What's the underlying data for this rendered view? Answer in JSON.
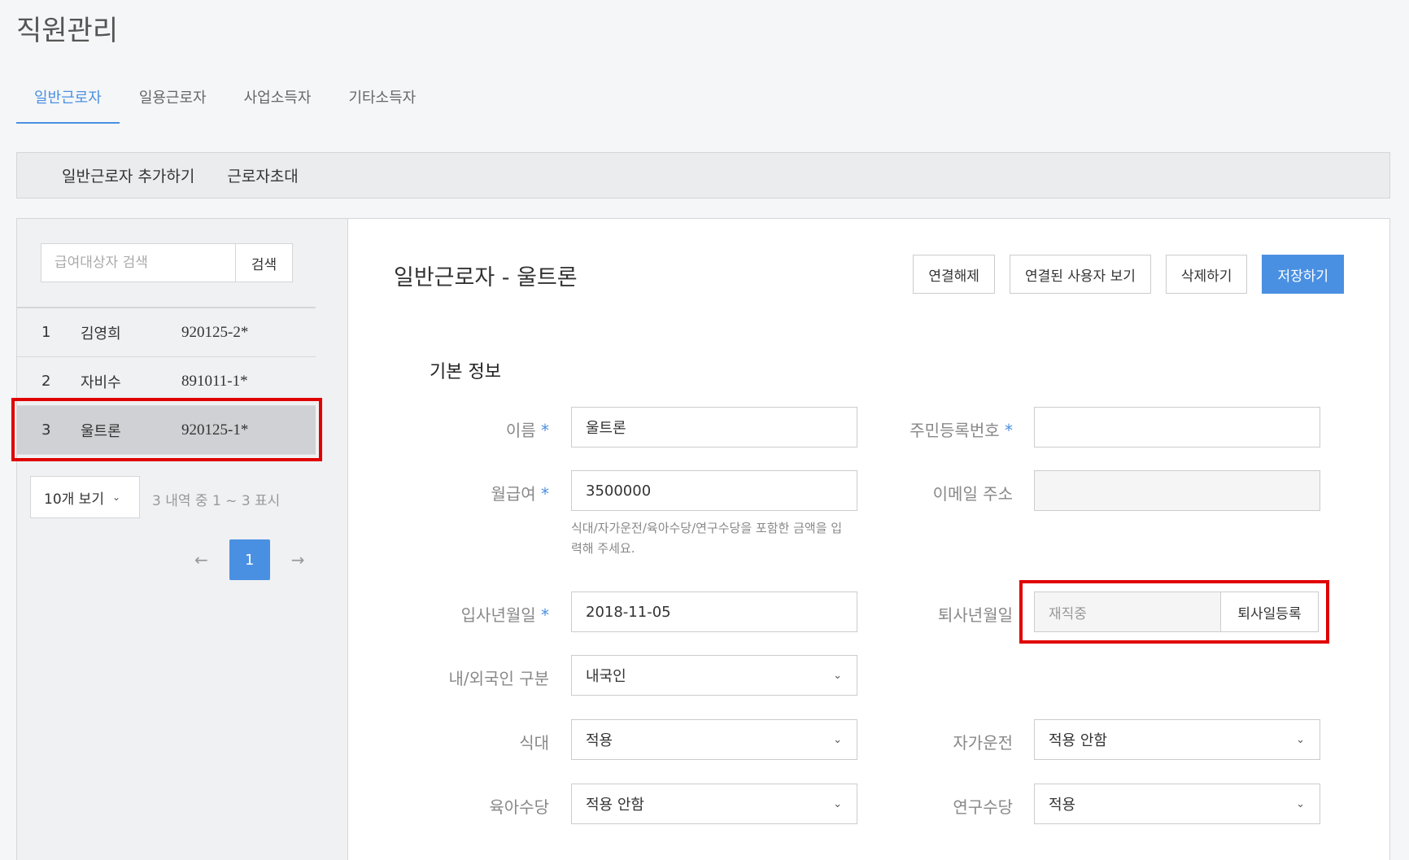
{
  "page": {
    "title": "직원관리"
  },
  "tabs": [
    {
      "label": "일반근로자",
      "active": true
    },
    {
      "label": "일용근로자",
      "active": false
    },
    {
      "label": "사업소득자",
      "active": false
    },
    {
      "label": "기타소득자",
      "active": false
    }
  ],
  "toolbar": {
    "add_label": "일반근로자 추가하기",
    "invite_label": "근로자초대"
  },
  "sidebar": {
    "search": {
      "placeholder": "급여대상자 검색",
      "button": "검색"
    },
    "employees": [
      {
        "no": "1",
        "name": "김영희",
        "id": "920125-2*"
      },
      {
        "no": "2",
        "name": "자비수",
        "id": "891011-1*"
      },
      {
        "no": "3",
        "name": "울트론",
        "id": "920125-1*",
        "selected": true
      }
    ],
    "page_size": "10개 보기",
    "page_info": "3 내역 중 1 ~ 3 표시",
    "pager": {
      "prev": "←",
      "current": "1",
      "next": "→"
    }
  },
  "detail": {
    "title": "일반근로자 - 울트론",
    "actions": {
      "unlink": "연결해제",
      "view_linked": "연결된 사용자 보기",
      "delete": "삭제하기",
      "save": "저장하기"
    },
    "section_title": "기본 정보",
    "fields": {
      "name": {
        "label": "이름",
        "value": "울트론"
      },
      "rrn": {
        "label": "주민등록번호",
        "value": ""
      },
      "salary": {
        "label": "월급여",
        "value": "3500000",
        "help": "식대/자가운전/육아수당/연구수당을 포함한 금액을 입력해 주세요."
      },
      "email": {
        "label": "이메일 주소",
        "value": ""
      },
      "join_date": {
        "label": "입사년월일",
        "value": "2018-11-05"
      },
      "resign_date": {
        "label": "퇴사년월일",
        "placeholder": "재직중",
        "button": "퇴사일등록"
      },
      "nationality": {
        "label": "내/외국인 구분",
        "value": "내국인"
      },
      "meal": {
        "label": "식대",
        "value": "적용"
      },
      "car": {
        "label": "자가운전",
        "value": "적용 안함"
      },
      "childcare": {
        "label": "육아수당",
        "value": "적용 안함"
      },
      "research": {
        "label": "연구수당",
        "value": "적용"
      }
    },
    "required_mark": "*"
  },
  "colors": {
    "accent": "#4a90e2",
    "highlight": "#e00000"
  }
}
